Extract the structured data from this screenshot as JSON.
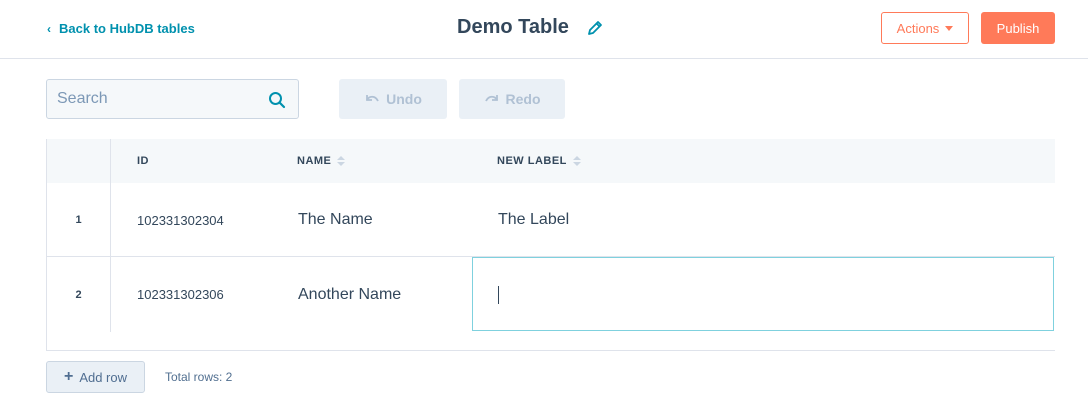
{
  "header": {
    "back_label": "Back to HubDB tables",
    "title": "Demo Table",
    "actions_label": "Actions",
    "publish_label": "Publish"
  },
  "toolbar": {
    "search_placeholder": "Search",
    "undo_label": "Undo",
    "redo_label": "Redo"
  },
  "table": {
    "columns": [
      "ID",
      "NAME",
      "NEW LABEL"
    ],
    "rows": [
      {
        "num": "1",
        "id": "102331302304",
        "name": "The Name",
        "label": "The Label"
      },
      {
        "num": "2",
        "id": "102331302306",
        "name": "Another Name",
        "label": ""
      }
    ]
  },
  "footer": {
    "add_row_label": "Add row",
    "total_rows": "Total rows: 2"
  },
  "colors": {
    "accent": "#ff7a59",
    "link": "#0091ae",
    "text": "#33475b",
    "edit_border": "#7fd1de"
  },
  "icons": [
    "chevron-left-icon",
    "pencil-icon",
    "caret-down-icon",
    "search-icon",
    "undo-icon",
    "redo-icon",
    "sort-icon",
    "plus-icon"
  ]
}
